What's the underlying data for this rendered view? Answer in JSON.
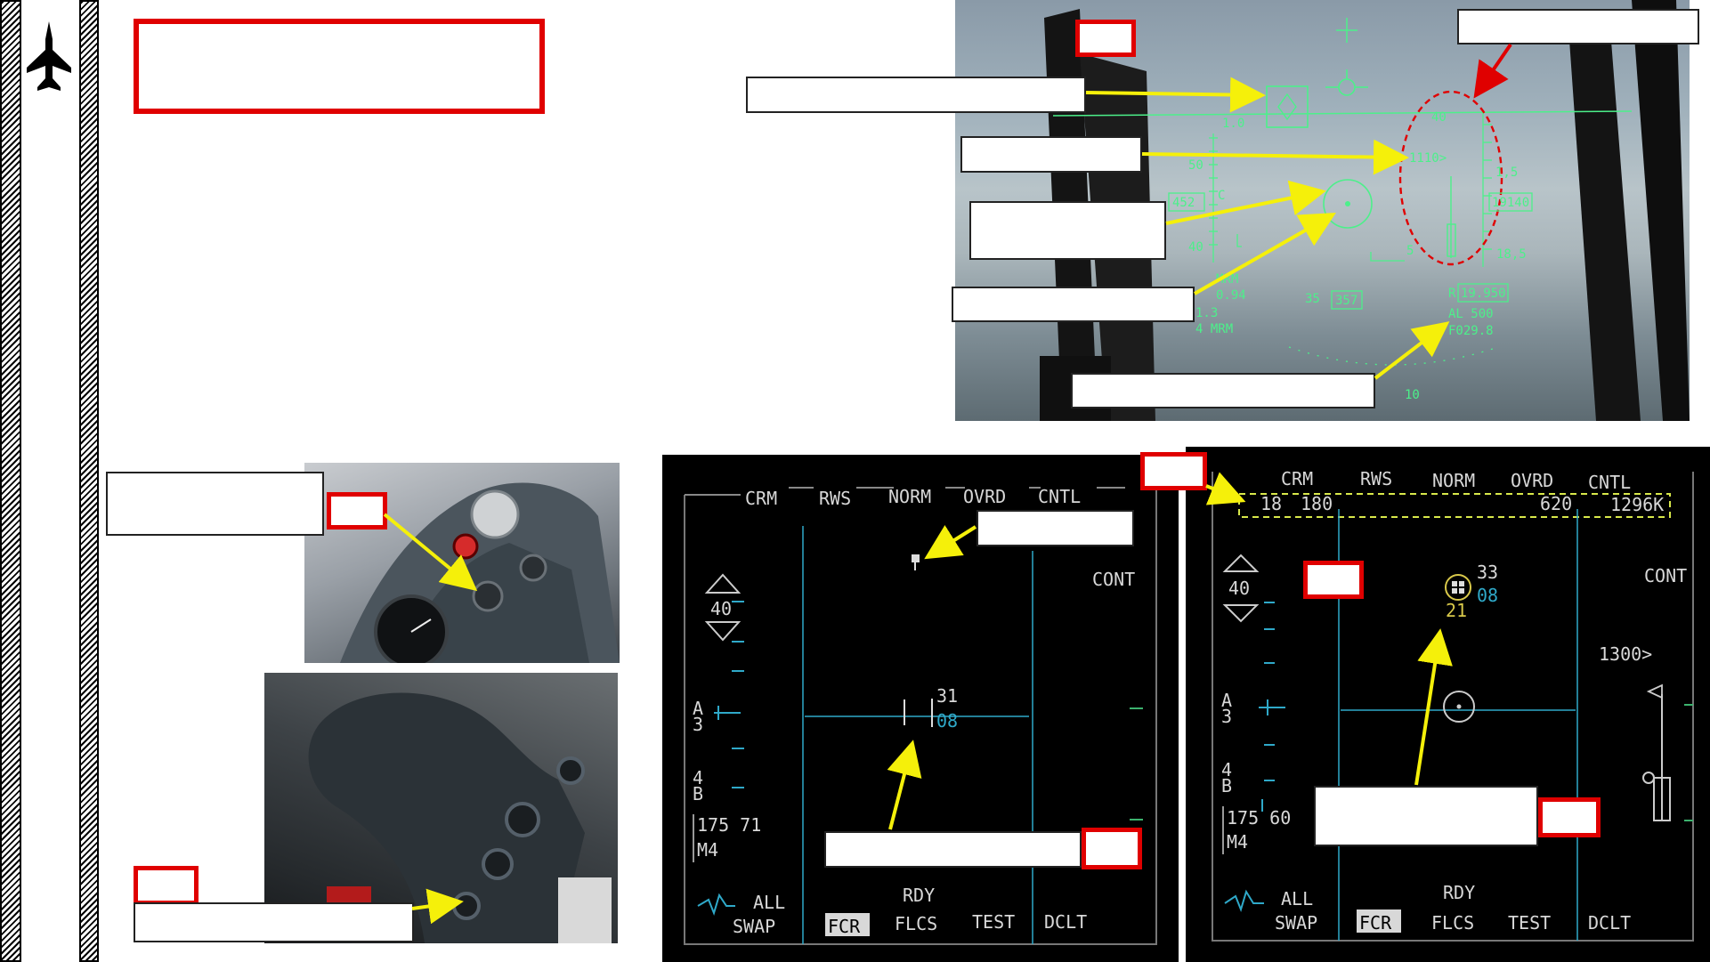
{
  "page": {
    "side_rail": "aircraft-icon"
  },
  "hud": {
    "scale_top": "40",
    "scale_10": "1.0",
    "scale_50": "50",
    "scale_c": "C",
    "scale_40": "40",
    "speed_box": "452",
    "alt_tick": "1110>",
    "alt_1_5": "1,5",
    "alt_box": "19140",
    "alt_18_5": "18,5",
    "scale_5": "5",
    "scale_10_bot": "10",
    "mrm_label": "MRM",
    "mach": "0.94",
    "g_value": "1.3",
    "weapon": "4 MRM",
    "heading_35": "35",
    "heading_box": "357",
    "range_label": "R",
    "range_box": "19.950",
    "al_label": "AL  500",
    "fuel": "F029.8"
  },
  "mfd_left": {
    "top_labels": [
      "CRM",
      "RWS",
      "NORM",
      "OVRD",
      "CNTL"
    ],
    "range": "40",
    "cont": "CONT",
    "az_a": "A",
    "az_3": "3",
    "bar_4": "4",
    "bar_b": "B",
    "readout": "175 71",
    "mode": "M4",
    "target_top": "31",
    "target_bot": "08",
    "bottom_all": "ALL",
    "bottom_rdy": "RDY",
    "bottom_labels": [
      "SWAP",
      "FCR",
      "FLCS",
      "TEST",
      "DCLT"
    ]
  },
  "mfd_right": {
    "top_labels": [
      "CRM",
      "RWS",
      "NORM",
      "OVRD",
      "CNTL"
    ],
    "bullseye_row": [
      "18",
      "180",
      "620",
      "1296K"
    ],
    "range": "40",
    "cont": "CONT",
    "alt_marker": "1300>",
    "az_a": "A",
    "az_3": "3",
    "bar_4": "4",
    "bar_b": "B",
    "readout": "175 60",
    "mode": "M4",
    "target_top": "33",
    "target_bot": "08",
    "target_alt": "21",
    "bottom_all": "ALL",
    "bottom_rdy": "RDY",
    "bottom_labels": [
      "SWAP",
      "FCR",
      "FLCS",
      "TEST",
      "DCLT"
    ]
  },
  "colors": {
    "callout_red": "#e00000",
    "arrow_yellow": "#f5f00a",
    "hud_green": "#4cf08a",
    "radar_cyan": "#2fa9c9",
    "radar_yellow": "#d8c84a"
  }
}
